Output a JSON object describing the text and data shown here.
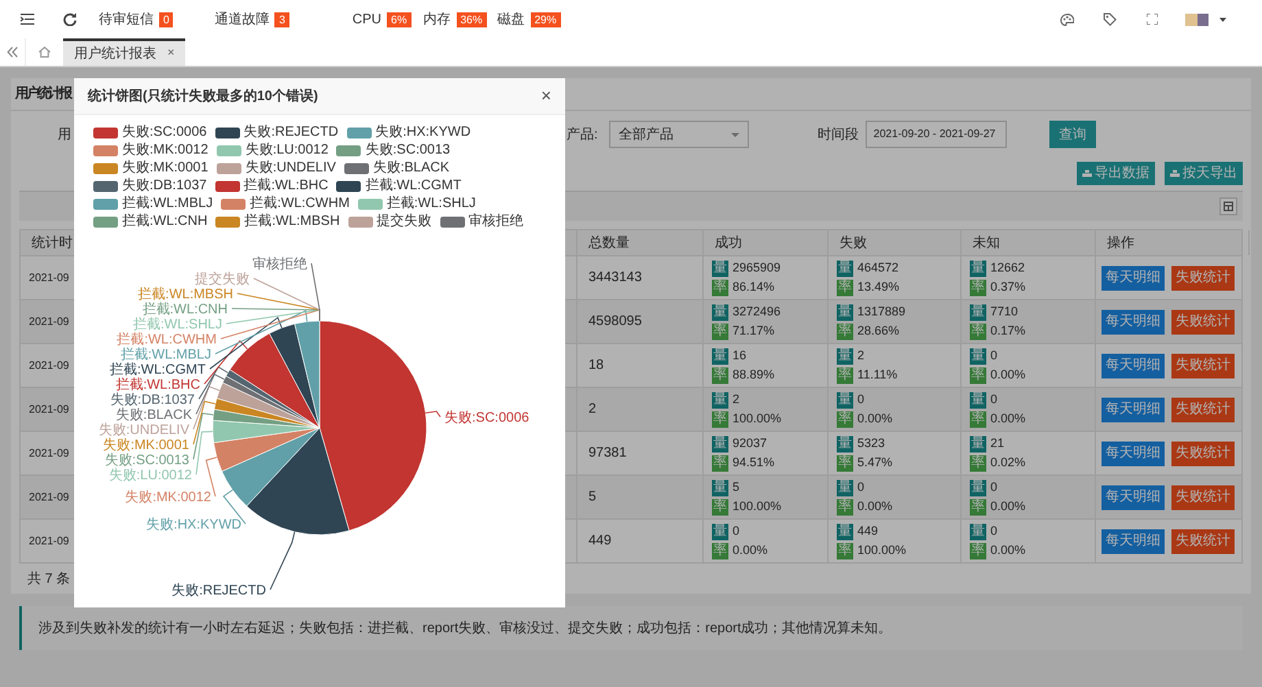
{
  "top_bar": {
    "indicators": [
      {
        "label": "待审短信",
        "badge": "0"
      },
      {
        "label": "通道故障",
        "badge": "3"
      },
      {
        "label": "CPU",
        "badge": "6%"
      },
      {
        "label": "内存",
        "badge": "36%"
      },
      {
        "label": "磁盘",
        "badge": "29%"
      }
    ]
  },
  "tabs": [
    {
      "label": "用户统计报表",
      "selected": true,
      "close": "×"
    }
  ],
  "page": {
    "title": "用户统计报",
    "filters": {
      "label_1": "用",
      "product_label": "产品:",
      "product_value": "全部产品",
      "period_label": "时间段",
      "period_value": "2021-09-20 - 2021-09-27",
      "query_button": "查询"
    },
    "export_buttons": [
      "导出数据",
      "按天导出"
    ],
    "table": {
      "columns": [
        "统计时",
        "总数量",
        "成功",
        "失败",
        "未知",
        "操作"
      ],
      "rows": [
        {
          "date": "2021-09",
          "total": "3443143",
          "stats": [
            {
              "count_tag": "量",
              "count": "2965909",
              "rate_tag": "率",
              "rate": "86.14%"
            },
            {
              "count_tag": "量",
              "count": "464572",
              "rate_tag": "率",
              "rate": "13.49%"
            },
            {
              "count_tag": "量",
              "count": "12662",
              "rate_tag": "率",
              "rate": "0.37%"
            }
          ],
          "actions": [
            "每天明细",
            "失败统计"
          ]
        },
        {
          "date": "2021-09",
          "total": "4598095",
          "stats": [
            {
              "count_tag": "量",
              "count": "3272496",
              "rate_tag": "率",
              "rate": "71.17%"
            },
            {
              "count_tag": "量",
              "count": "1317889",
              "rate_tag": "率",
              "rate": "28.66%"
            },
            {
              "count_tag": "量",
              "count": "7710",
              "rate_tag": "率",
              "rate": "0.17%"
            }
          ],
          "actions": [
            "每天明细",
            "失败统计"
          ]
        },
        {
          "date": "2021-09",
          "total": "18",
          "stats": [
            {
              "count_tag": "量",
              "count": "16",
              "rate_tag": "率",
              "rate": "88.89%"
            },
            {
              "count_tag": "量",
              "count": "2",
              "rate_tag": "率",
              "rate": "11.11%"
            },
            {
              "count_tag": "量",
              "count": "0",
              "rate_tag": "率",
              "rate": "0.00%"
            }
          ],
          "actions": [
            "每天明细",
            "失败统计"
          ]
        },
        {
          "date": "2021-09",
          "total": "2",
          "stats": [
            {
              "count_tag": "量",
              "count": "2",
              "rate_tag": "率",
              "rate": "100.00%"
            },
            {
              "count_tag": "量",
              "count": "0",
              "rate_tag": "率",
              "rate": "0.00%"
            },
            {
              "count_tag": "量",
              "count": "0",
              "rate_tag": "率",
              "rate": "0.00%"
            }
          ],
          "actions": [
            "每天明细",
            "失败统计"
          ]
        },
        {
          "date": "2021-09",
          "total": "97381",
          "stats": [
            {
              "count_tag": "量",
              "count": "92037",
              "rate_tag": "率",
              "rate": "94.51%"
            },
            {
              "count_tag": "量",
              "count": "5323",
              "rate_tag": "率",
              "rate": "5.47%"
            },
            {
              "count_tag": "量",
              "count": "21",
              "rate_tag": "率",
              "rate": "0.02%"
            }
          ],
          "actions": [
            "每天明细",
            "失败统计"
          ]
        },
        {
          "date": "2021-09",
          "total": "5",
          "stats": [
            {
              "count_tag": "量",
              "count": "5",
              "rate_tag": "率",
              "rate": "100.00%"
            },
            {
              "count_tag": "量",
              "count": "0",
              "rate_tag": "率",
              "rate": "0.00%"
            },
            {
              "count_tag": "量",
              "count": "0",
              "rate_tag": "率",
              "rate": "0.00%"
            }
          ],
          "actions": [
            "每天明细",
            "失败统计"
          ]
        },
        {
          "date": "2021-09",
          "total": "449",
          "stats": [
            {
              "count_tag": "量",
              "count": "0",
              "rate_tag": "率",
              "rate": "0.00%"
            },
            {
              "count_tag": "量",
              "count": "449",
              "rate_tag": "率",
              "rate": "100.00%"
            },
            {
              "count_tag": "量",
              "count": "0",
              "rate_tag": "率",
              "rate": "0.00%"
            }
          ],
          "actions": [
            "每天明细",
            "失败统计"
          ]
        }
      ]
    },
    "total": "共 7 条",
    "notice": "涉及到失败补发的统计有一小时左右延迟；失败包括：进拦截、report失败、审核没过、提交失败；成功包括：report成功；其他情况算未知。"
  },
  "dialog": {
    "title": "统计饼图(只统计失败最多的10个错误)",
    "close": "×",
    "chart_data": {
      "type": "pie",
      "categories": [
        "失败:SC:0006",
        "失败:REJECTD",
        "失败:HX:KYWD",
        "失败:MK:0012",
        "失败:LU:0012",
        "失败:SC:0013",
        "失败:MK:0001",
        "失败:UNDELIV",
        "失败:BLACK",
        "失败:DB:1037",
        "拦截:WL:BHC",
        "拦截:WL:CGMT",
        "拦截:WL:MBLJ",
        "拦截:WL:CWHM",
        "拦截:WL:SHLJ",
        "拦截:WL:CNH",
        "拦截:WL:MBSH",
        "提交失败",
        "审核拒绝"
      ],
      "values": [
        164,
        59,
        23,
        16,
        12,
        6,
        6,
        9,
        4,
        4,
        29,
        14.5,
        13.5,
        null,
        null,
        null,
        null,
        null,
        null
      ],
      "legend": "top"
    }
  }
}
